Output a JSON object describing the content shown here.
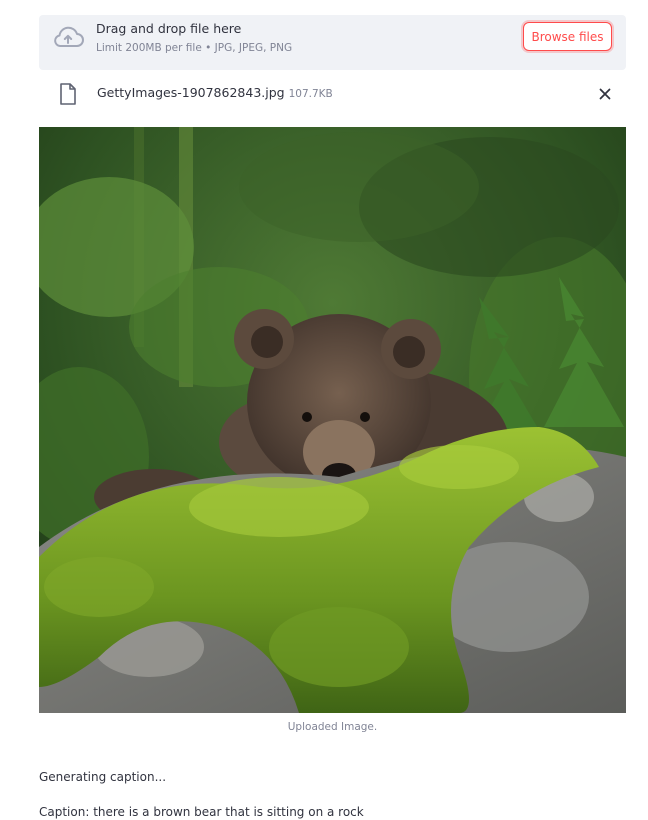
{
  "uploader": {
    "title": "Drag and drop file here",
    "subtitle": "Limit 200MB per file • JPG, JPEG, PNG",
    "browse_label": "Browse files",
    "icon": "cloud-upload-icon"
  },
  "file": {
    "name": "GettyImages-1907862843.jpg",
    "size": "107.7KB",
    "icon": "file-icon",
    "remove_icon": "close-icon"
  },
  "image": {
    "caption": "Uploaded Image."
  },
  "output": {
    "status": "Generating caption...",
    "caption": "Caption: there is a brown bear that is sitting on a rock"
  },
  "colors": {
    "accent": "#ff4b4b",
    "dropzone_bg": "#f0f2f6",
    "text": "#31333f",
    "muted": "#808495"
  }
}
